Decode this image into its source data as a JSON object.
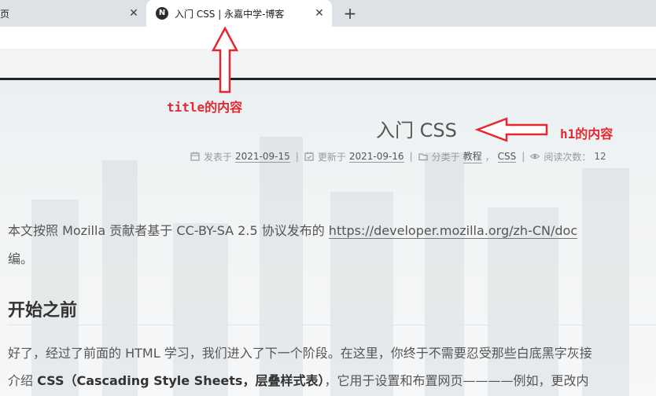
{
  "browser": {
    "tabs": [
      {
        "title": "页",
        "active": false
      },
      {
        "title": "入门 CSS | 永嘉中学-博客",
        "favicon": "N",
        "active": true
      }
    ],
    "close_glyph": "✕",
    "new_tab_glyph": "+"
  },
  "post": {
    "title": "入门 CSS",
    "meta": {
      "published_label": "发表于",
      "published_date": "2021-09-15",
      "updated_label": "更新于",
      "updated_date": "2021-09-16",
      "category_label": "分类于",
      "categories": [
        "教程",
        "CSS"
      ],
      "views_label": "阅读次数：",
      "views": "12",
      "sep": "|",
      "comma": "，"
    },
    "intro_line1_prefix": "本文按照 Mozilla 贡献者基于 CC-BY-SA 2.5 协议发布的 ",
    "intro_url": "https://developer.mozilla.org/zh-CN/doc",
    "intro_line2": "编。",
    "heading": "开始之前",
    "para1": "好了，经过了前面的 HTML 学习，我们进入了下一个阶段。在这里，你终于不需要忍受那些白底黑字灰接",
    "para2_prefix": "介绍 ",
    "para2_bold": "CSS（Cascading Style Sheets，层叠样式表）",
    "para2_suffix": "，它用于设置和布置网页————例如，更改内"
  },
  "annotations": {
    "title_label": "title的内容",
    "h1_label": "h1的内容",
    "color": "#e8262f"
  },
  "icons": {
    "calendar": "calendar-icon",
    "calendar_check": "calendar-check-icon",
    "folder": "folder-icon",
    "eye": "eye-icon"
  }
}
